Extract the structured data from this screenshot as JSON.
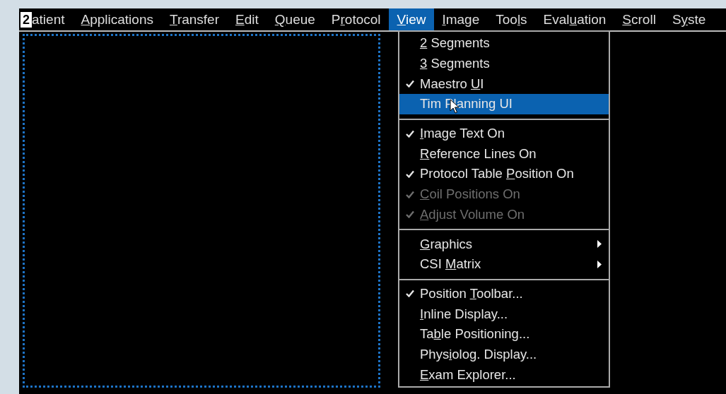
{
  "menubar": {
    "badge": "2",
    "items": [
      {
        "pre": "atient",
        "selected": false
      },
      {
        "mnemonic": "A",
        "post": "pplications",
        "selected": false
      },
      {
        "mnemonic": "T",
        "post": "ransfer",
        "selected": false
      },
      {
        "mnemonic": "E",
        "post": "dit",
        "selected": false
      },
      {
        "mnemonic": "Q",
        "post": "ueue",
        "selected": false
      },
      {
        "pre": "P",
        "mnemonic": "r",
        "post": "otocol",
        "selected": false
      },
      {
        "mnemonic": "V",
        "post": "iew",
        "selected": true
      },
      {
        "mnemonic": "I",
        "post": "mage",
        "selected": false
      },
      {
        "pre": "Too",
        "mnemonic": "l",
        "post": "s",
        "selected": false
      },
      {
        "pre": "Eval",
        "mnemonic": "u",
        "post": "ation",
        "selected": false
      },
      {
        "mnemonic": "S",
        "post": "croll",
        "selected": false
      },
      {
        "pre": "S",
        "mnemonic": "y",
        "post": "ste",
        "selected": false
      }
    ]
  },
  "view_menu": [
    {
      "kind": "item",
      "mnemonic": "2",
      "post": " Segments",
      "checked": false,
      "disabled": false,
      "selected": false
    },
    {
      "kind": "item",
      "mnemonic": "3",
      "post": " Segments",
      "checked": false,
      "disabled": false,
      "selected": false
    },
    {
      "kind": "item",
      "pre": "Maestro ",
      "mnemonic": "U",
      "post": "I",
      "checked": true,
      "disabled": false,
      "selected": false
    },
    {
      "kind": "item",
      "pre": "Tim Planning UI",
      "checked": false,
      "disabled": false,
      "selected": true
    },
    {
      "kind": "separator"
    },
    {
      "kind": "item",
      "mnemonic": "I",
      "post": "mage Text On",
      "checked": true,
      "disabled": false,
      "selected": false
    },
    {
      "kind": "item",
      "mnemonic": "R",
      "post": "eference Lines On",
      "checked": false,
      "disabled": false,
      "selected": false
    },
    {
      "kind": "item",
      "pre": "Protocol Table ",
      "mnemonic": "P",
      "post": "osition On",
      "checked": true,
      "disabled": false,
      "selected": false
    },
    {
      "kind": "item",
      "mnemonic": "C",
      "post": "oil Positions On",
      "checked": true,
      "disabled": true,
      "selected": false
    },
    {
      "kind": "item",
      "mnemonic": "A",
      "post": "djust Volume On",
      "checked": true,
      "disabled": true,
      "selected": false
    },
    {
      "kind": "separator"
    },
    {
      "kind": "submenu",
      "mnemonic": "G",
      "post": "raphics",
      "checked": false,
      "disabled": false,
      "selected": false
    },
    {
      "kind": "submenu",
      "pre": "CSI ",
      "mnemonic": "M",
      "post": "atrix",
      "checked": false,
      "disabled": false,
      "selected": false
    },
    {
      "kind": "separator"
    },
    {
      "kind": "item",
      "pre": "Position ",
      "mnemonic": "T",
      "post": "oolbar...",
      "checked": true,
      "disabled": false,
      "selected": false
    },
    {
      "kind": "item",
      "mnemonic": "I",
      "post": "nline Display...",
      "checked": false,
      "disabled": false,
      "selected": false
    },
    {
      "kind": "item",
      "pre": "Ta",
      "mnemonic": "b",
      "post": "le Positioning...",
      "checked": false,
      "disabled": false,
      "selected": false
    },
    {
      "kind": "item",
      "pre": "Phys",
      "mnemonic": "i",
      "post": "olog. Display...",
      "checked": false,
      "disabled": false,
      "selected": false
    },
    {
      "kind": "item",
      "mnemonic": "E",
      "post": "xam Explorer...",
      "checked": false,
      "disabled": false,
      "selected": false
    }
  ]
}
